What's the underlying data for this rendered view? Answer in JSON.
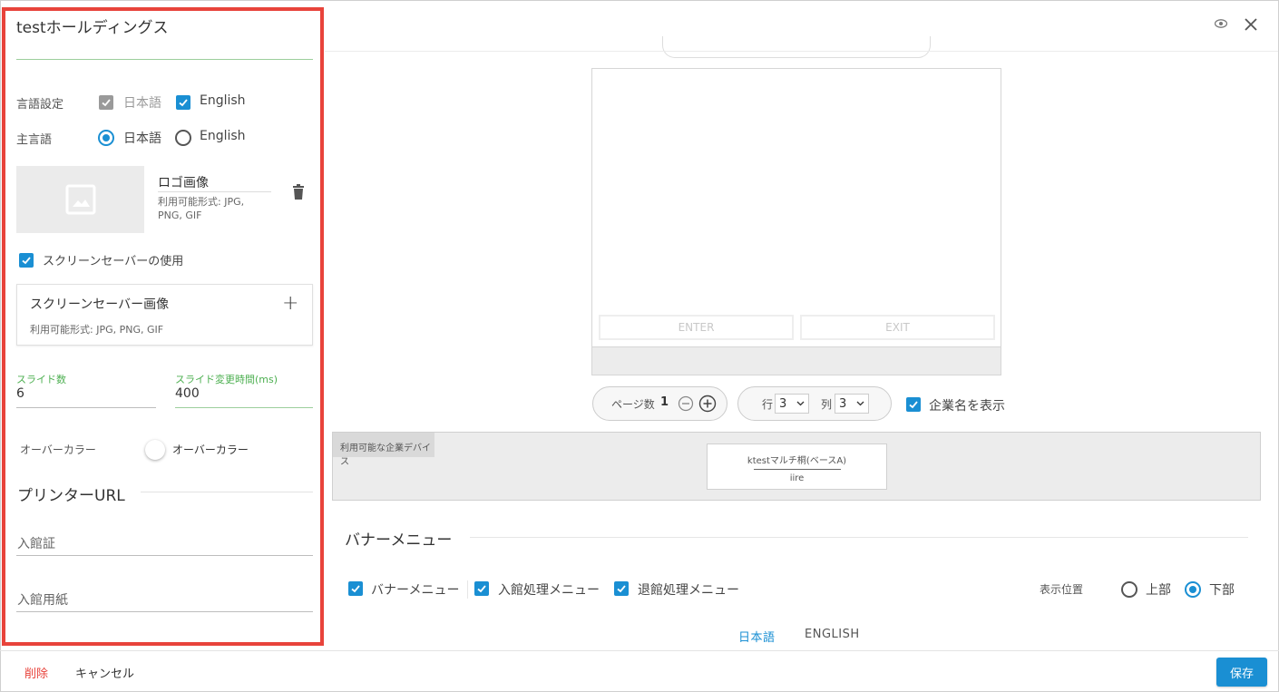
{
  "panel": {
    "title": "testホールディングス",
    "language_setting_label": "言語設定",
    "languages": [
      "日本語",
      "English"
    ],
    "main_language_label": "主言語",
    "main_language_options": [
      "日本語",
      "English"
    ],
    "main_language_selected": "日本語",
    "logo": {
      "title": "ロゴ画像",
      "formats": "利用可能形式: JPG, PNG, GIF"
    },
    "screensaver_checkbox_label": "スクリーンセーバーの使用",
    "screensaver_card": {
      "title": "スクリーンセーバー画像",
      "formats": "利用可能形式: JPG, PNG, GIF"
    },
    "slide_count": {
      "label": "スライド数",
      "value": "6"
    },
    "slide_interval": {
      "label": "スライド変更時間(ms)",
      "value": "400"
    },
    "over_color_label": "オーバーカラー",
    "over_color_toggle_label": "オーバーカラー",
    "printer_section": "プリンターURL",
    "admission_ticket_placeholder": "入館証",
    "admission_paper_placeholder": "入館用紙"
  },
  "preview": {
    "enter_label": "ENTER",
    "exit_label": "EXIT"
  },
  "pagination": {
    "pages_label": "ページ数",
    "pages_value": "1",
    "rows_label": "行",
    "rows_value": "3",
    "cols_label": "列",
    "cols_value": "3",
    "show_company_label": "企業名を表示"
  },
  "devices": {
    "tab_label": "利用可能な企業デバイス",
    "card_name": "ktestマルチ桐(ベースA)",
    "card_sub": "iire"
  },
  "banner": {
    "section_title": "バナーメニュー",
    "checkboxes": [
      "バナーメニュー",
      "入館処理メニュー",
      "退館処理メニュー"
    ],
    "position_label": "表示位置",
    "position_options": [
      "上部",
      "下部"
    ],
    "position_selected": "下部"
  },
  "lang_tabs": [
    "日本語",
    "ENGLISH"
  ],
  "footer": {
    "delete_label": "削除",
    "cancel_label": "キャンセル",
    "save_label": "保存"
  },
  "colors": {
    "accent": "#1a8fd3",
    "danger": "#e8433b",
    "green": "#4caf50"
  }
}
